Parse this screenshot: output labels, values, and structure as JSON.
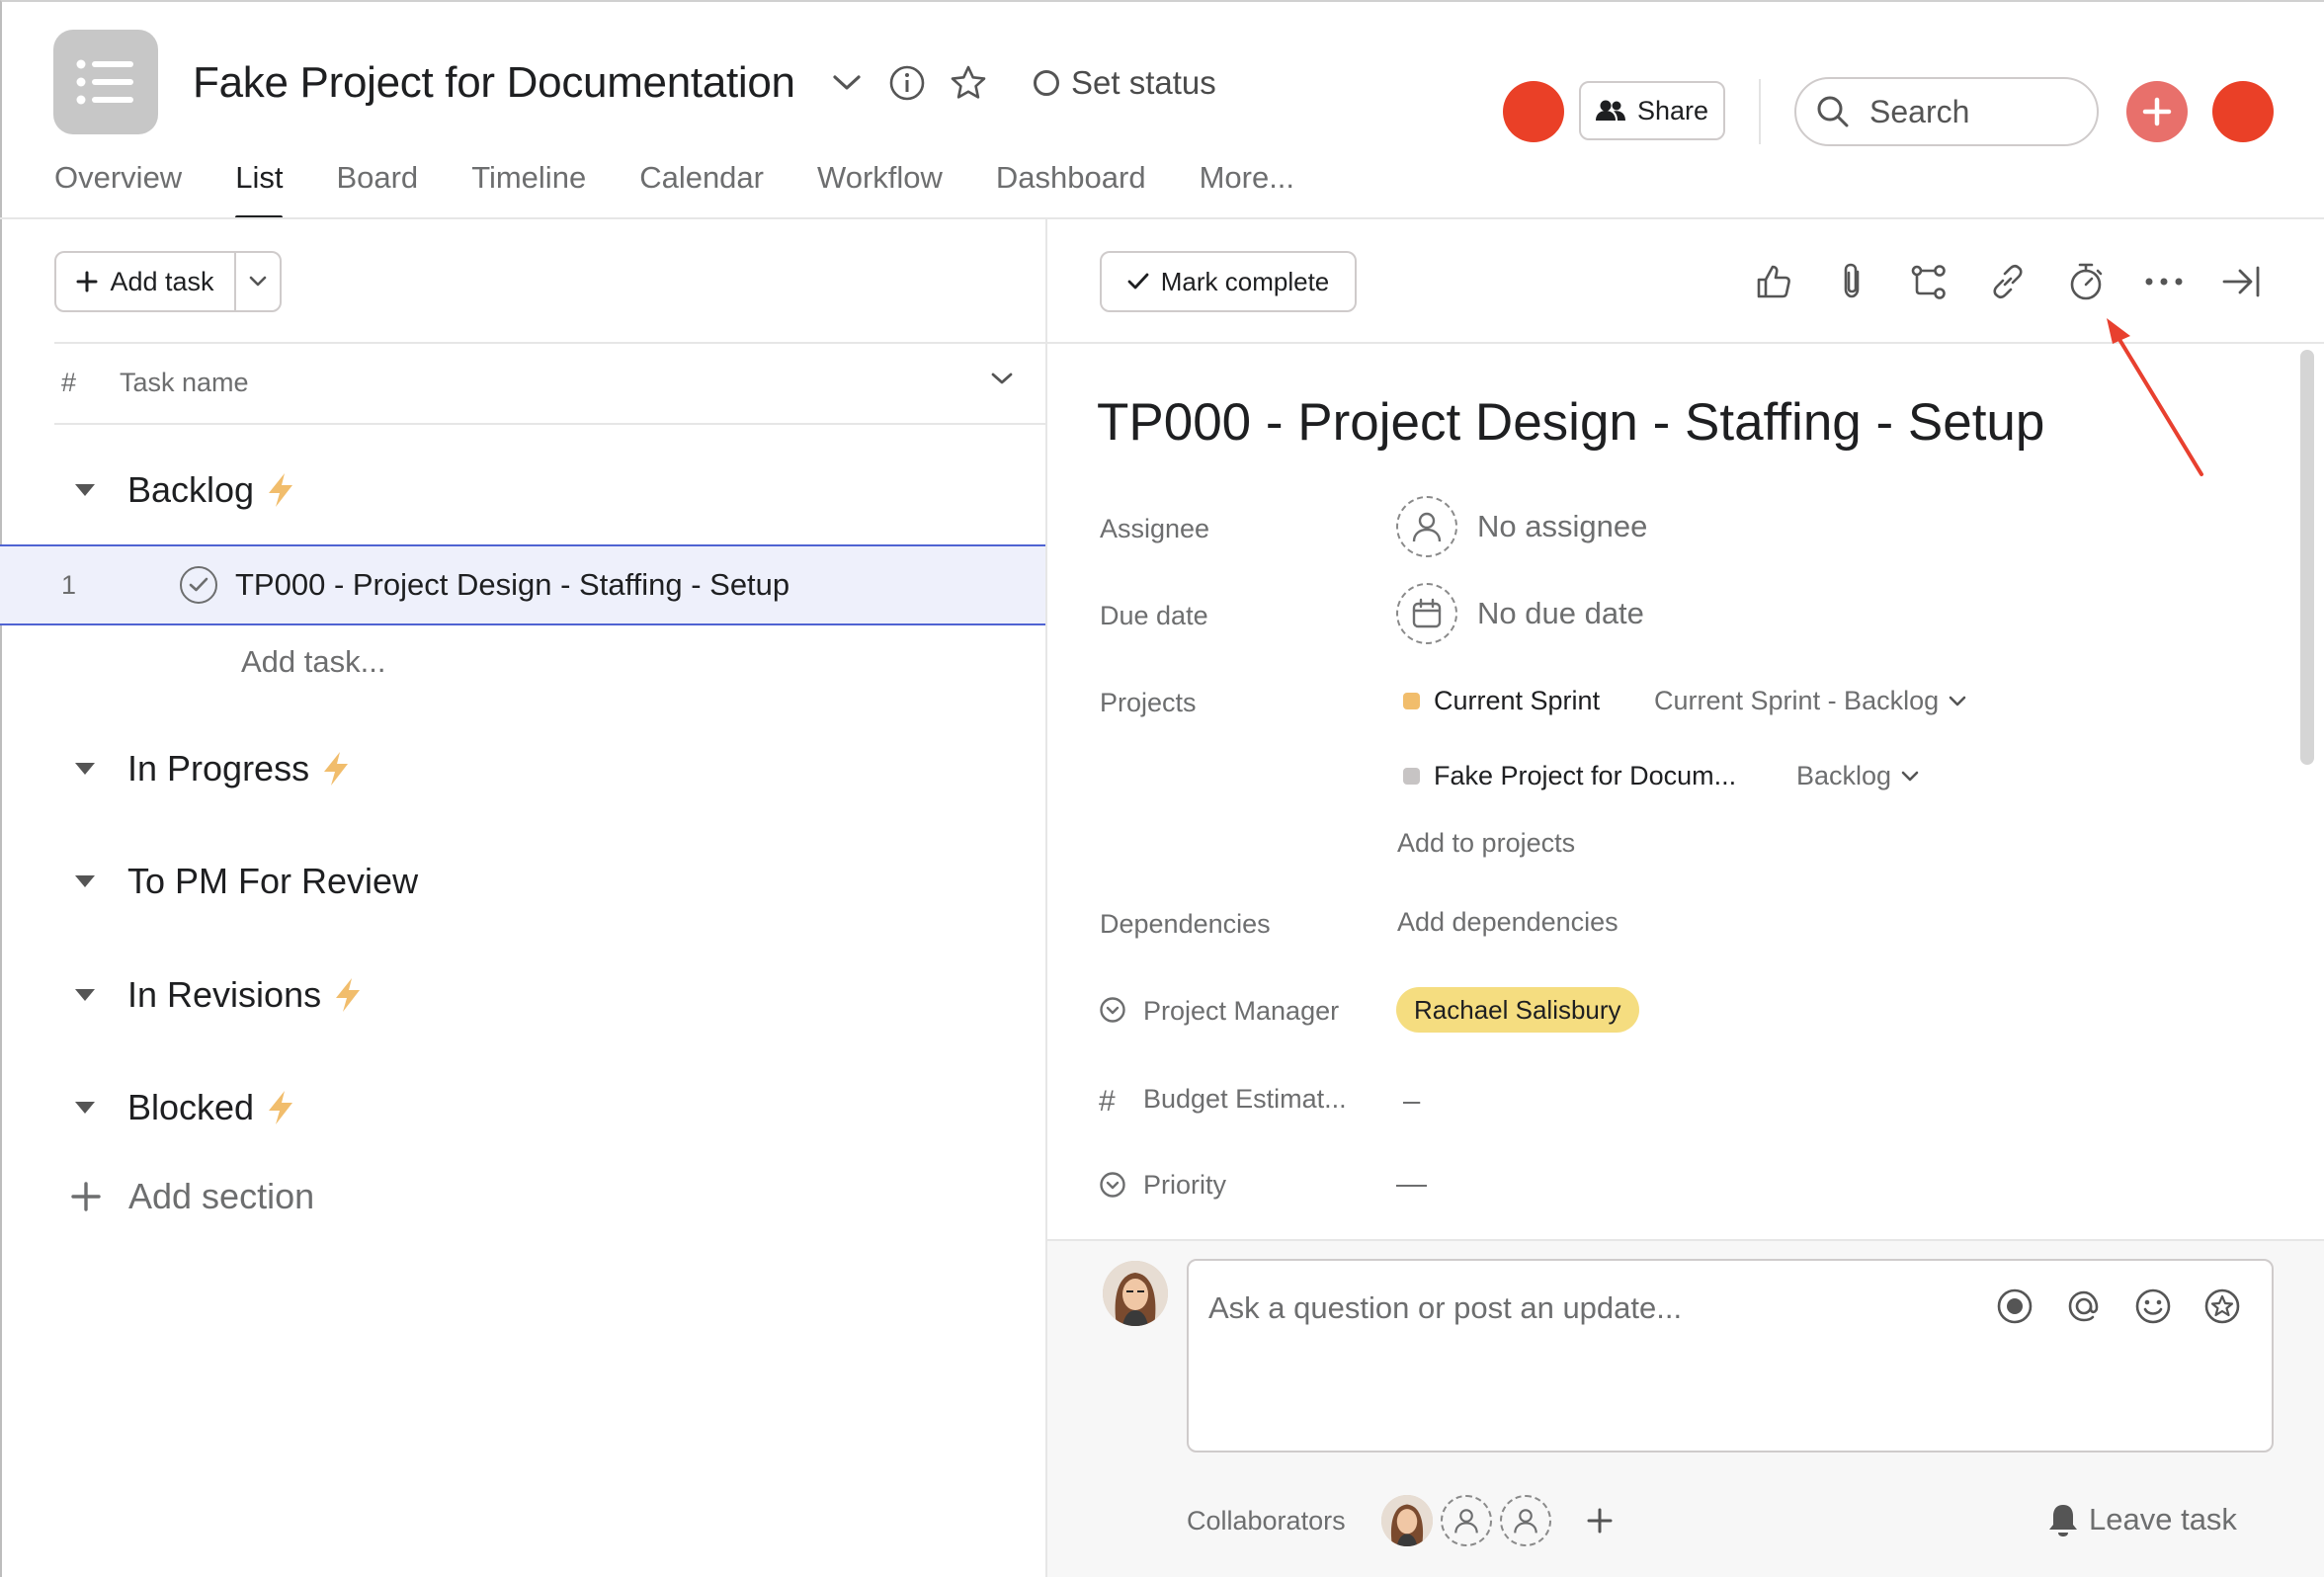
{
  "header": {
    "project_title": "Fake Project for Documentation",
    "set_status_label": "Set status",
    "share_label": "Share",
    "search_placeholder": "Search"
  },
  "tabs": [
    {
      "label": "Overview",
      "active": false
    },
    {
      "label": "List",
      "active": true
    },
    {
      "label": "Board",
      "active": false
    },
    {
      "label": "Timeline",
      "active": false
    },
    {
      "label": "Calendar",
      "active": false
    },
    {
      "label": "Workflow",
      "active": false
    },
    {
      "label": "Dashboard",
      "active": false
    },
    {
      "label": "More...",
      "active": false
    }
  ],
  "list": {
    "add_task_label": "Add task",
    "col_hash": "#",
    "col_task_name": "Task name",
    "sections": [
      {
        "title": "Backlog",
        "has_rule": true
      },
      {
        "title": "In Progress",
        "has_rule": true
      },
      {
        "title": "To PM For Review",
        "has_rule": false
      },
      {
        "title": "In Revisions",
        "has_rule": true
      },
      {
        "title": "Blocked",
        "has_rule": true
      }
    ],
    "tasks": [
      {
        "number": "1",
        "name": "TP000 - Project Design - Staffing - Setup"
      }
    ],
    "add_task_inline": "Add task...",
    "add_section_label": "Add section"
  },
  "detail": {
    "mark_complete_label": "Mark complete",
    "title": "TP000 - Project Design - Staffing - Setup",
    "assignee_label": "Assignee",
    "assignee_value": "No assignee",
    "due_date_label": "Due date",
    "due_date_value": "No due date",
    "projects_label": "Projects",
    "projects": [
      {
        "name": "Current Sprint",
        "section": "Current Sprint - Backlog",
        "color": "#f1bd6c"
      },
      {
        "name": "Fake Project for Docum...",
        "section": "Backlog",
        "color": "#c7c4c4"
      }
    ],
    "add_to_projects": "Add to projects",
    "dependencies_label": "Dependencies",
    "add_dependencies": "Add dependencies",
    "project_manager_label": "Project Manager",
    "project_manager_value": "Rachael Salisbury",
    "budget_label": "Budget Estimat...",
    "budget_value": "–",
    "priority_label": "Priority",
    "priority_value": "—",
    "comment_placeholder": "Ask a question or post an update...",
    "collaborators_label": "Collaborators",
    "leave_task_label": "Leave task"
  },
  "colors": {
    "accent_red": "#ea4027",
    "plus_button": "#e8706b",
    "rule_bolt": "#f1bd6c",
    "selected_row_bg": "#eef0fb",
    "selected_row_border": "#4f63d2",
    "pm_pill": "#f5dd80",
    "annotation_arrow": "#e8402f"
  },
  "icons": [
    "list-icon",
    "chevron-down-icon",
    "info-icon",
    "star-icon",
    "people-icon",
    "search-icon",
    "plus-icon",
    "thumbs-up-icon",
    "paperclip-icon",
    "subtask-icon",
    "link-icon",
    "stopwatch-icon",
    "more-icon",
    "close-panel-icon",
    "lightning-icon",
    "record-icon",
    "mention-icon",
    "emoji-icon",
    "appreciation-icon",
    "bell-icon"
  ]
}
